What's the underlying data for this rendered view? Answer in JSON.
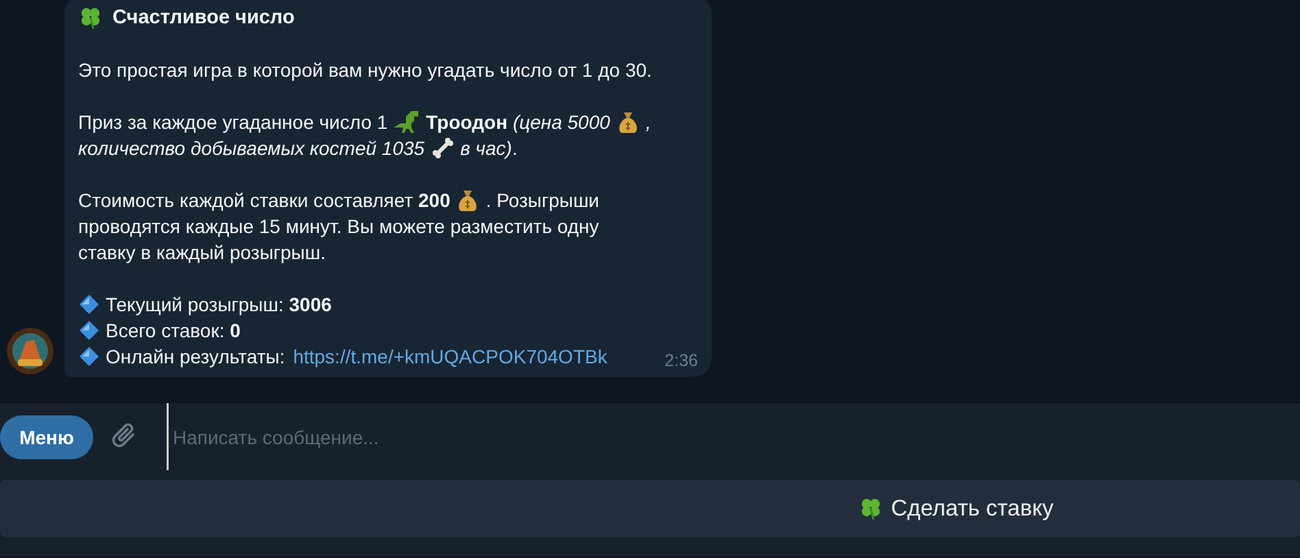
{
  "message": {
    "lines": [
      [
        {
          "kind": "icon"
        },
        {
          "kind": "title",
          "text": "Счастливое число"
        }
      ],
      [
        {
          "kind": "gap"
        }
      ],
      [
        {
          "kind": "text",
          "text": "Это простая игра в которой вам нужно угадать число от 1 до 30."
        }
      ],
      [
        {
          "kind": "gap"
        }
      ],
      [
        {
          "kind": "text",
          "text": "Приз за каждое угаданное число 1"
        },
        {
          "kind": "icon"
        },
        {
          "kind": "text",
          "text": "**Троодон** *(цена 5000*"
        },
        {
          "kind": "icon"
        },
        {
          "kind": "text",
          "text": "*,*"
        }
      ],
      [
        {
          "kind": "text",
          "text": "*количество добываемых костей 1035*"
        },
        {
          "kind": "icon"
        },
        {
          "kind": "text",
          "text": "*в час)*."
        }
      ],
      [
        {
          "kind": "gap"
        }
      ],
      [
        {
          "kind": "text",
          "text": "Стоимость каждой ставки составляет **200**"
        },
        {
          "kind": "icon"
        },
        {
          "kind": "text",
          "text": ". Розыгрыши"
        }
      ],
      [
        {
          "kind": "text",
          "text": "проводятся каждые 15 минут. Вы можете разместить одну"
        }
      ],
      [
        {
          "kind": "text",
          "text": "ставку в каждый розыгрыш."
        }
      ],
      [
        {
          "kind": "gap"
        }
      ],
      [
        {
          "kind": "icon"
        },
        {
          "kind": "text",
          "text": "Текущий розыгрыш: **3006**"
        }
      ],
      [
        {
          "kind": "icon"
        },
        {
          "kind": "text",
          "text": "Всего ставок: **0**"
        }
      ],
      [
        {
          "kind": "icon"
        },
        {
          "kind": "text",
          "text": "Онлайн результаты:"
        },
        {
          "kind": "link",
          "text": "https://t.me/+kmUQACPOK704OTBk"
        }
      ]
    ],
    "time": "2:36"
  },
  "composer": {
    "menu_button": "Меню",
    "placeholder": "Написать сообщение..."
  },
  "keyboard": {
    "buttons": [
      {
        "kind": "icon-label",
        "label": "Сделать ставку"
      }
    ]
  }
}
